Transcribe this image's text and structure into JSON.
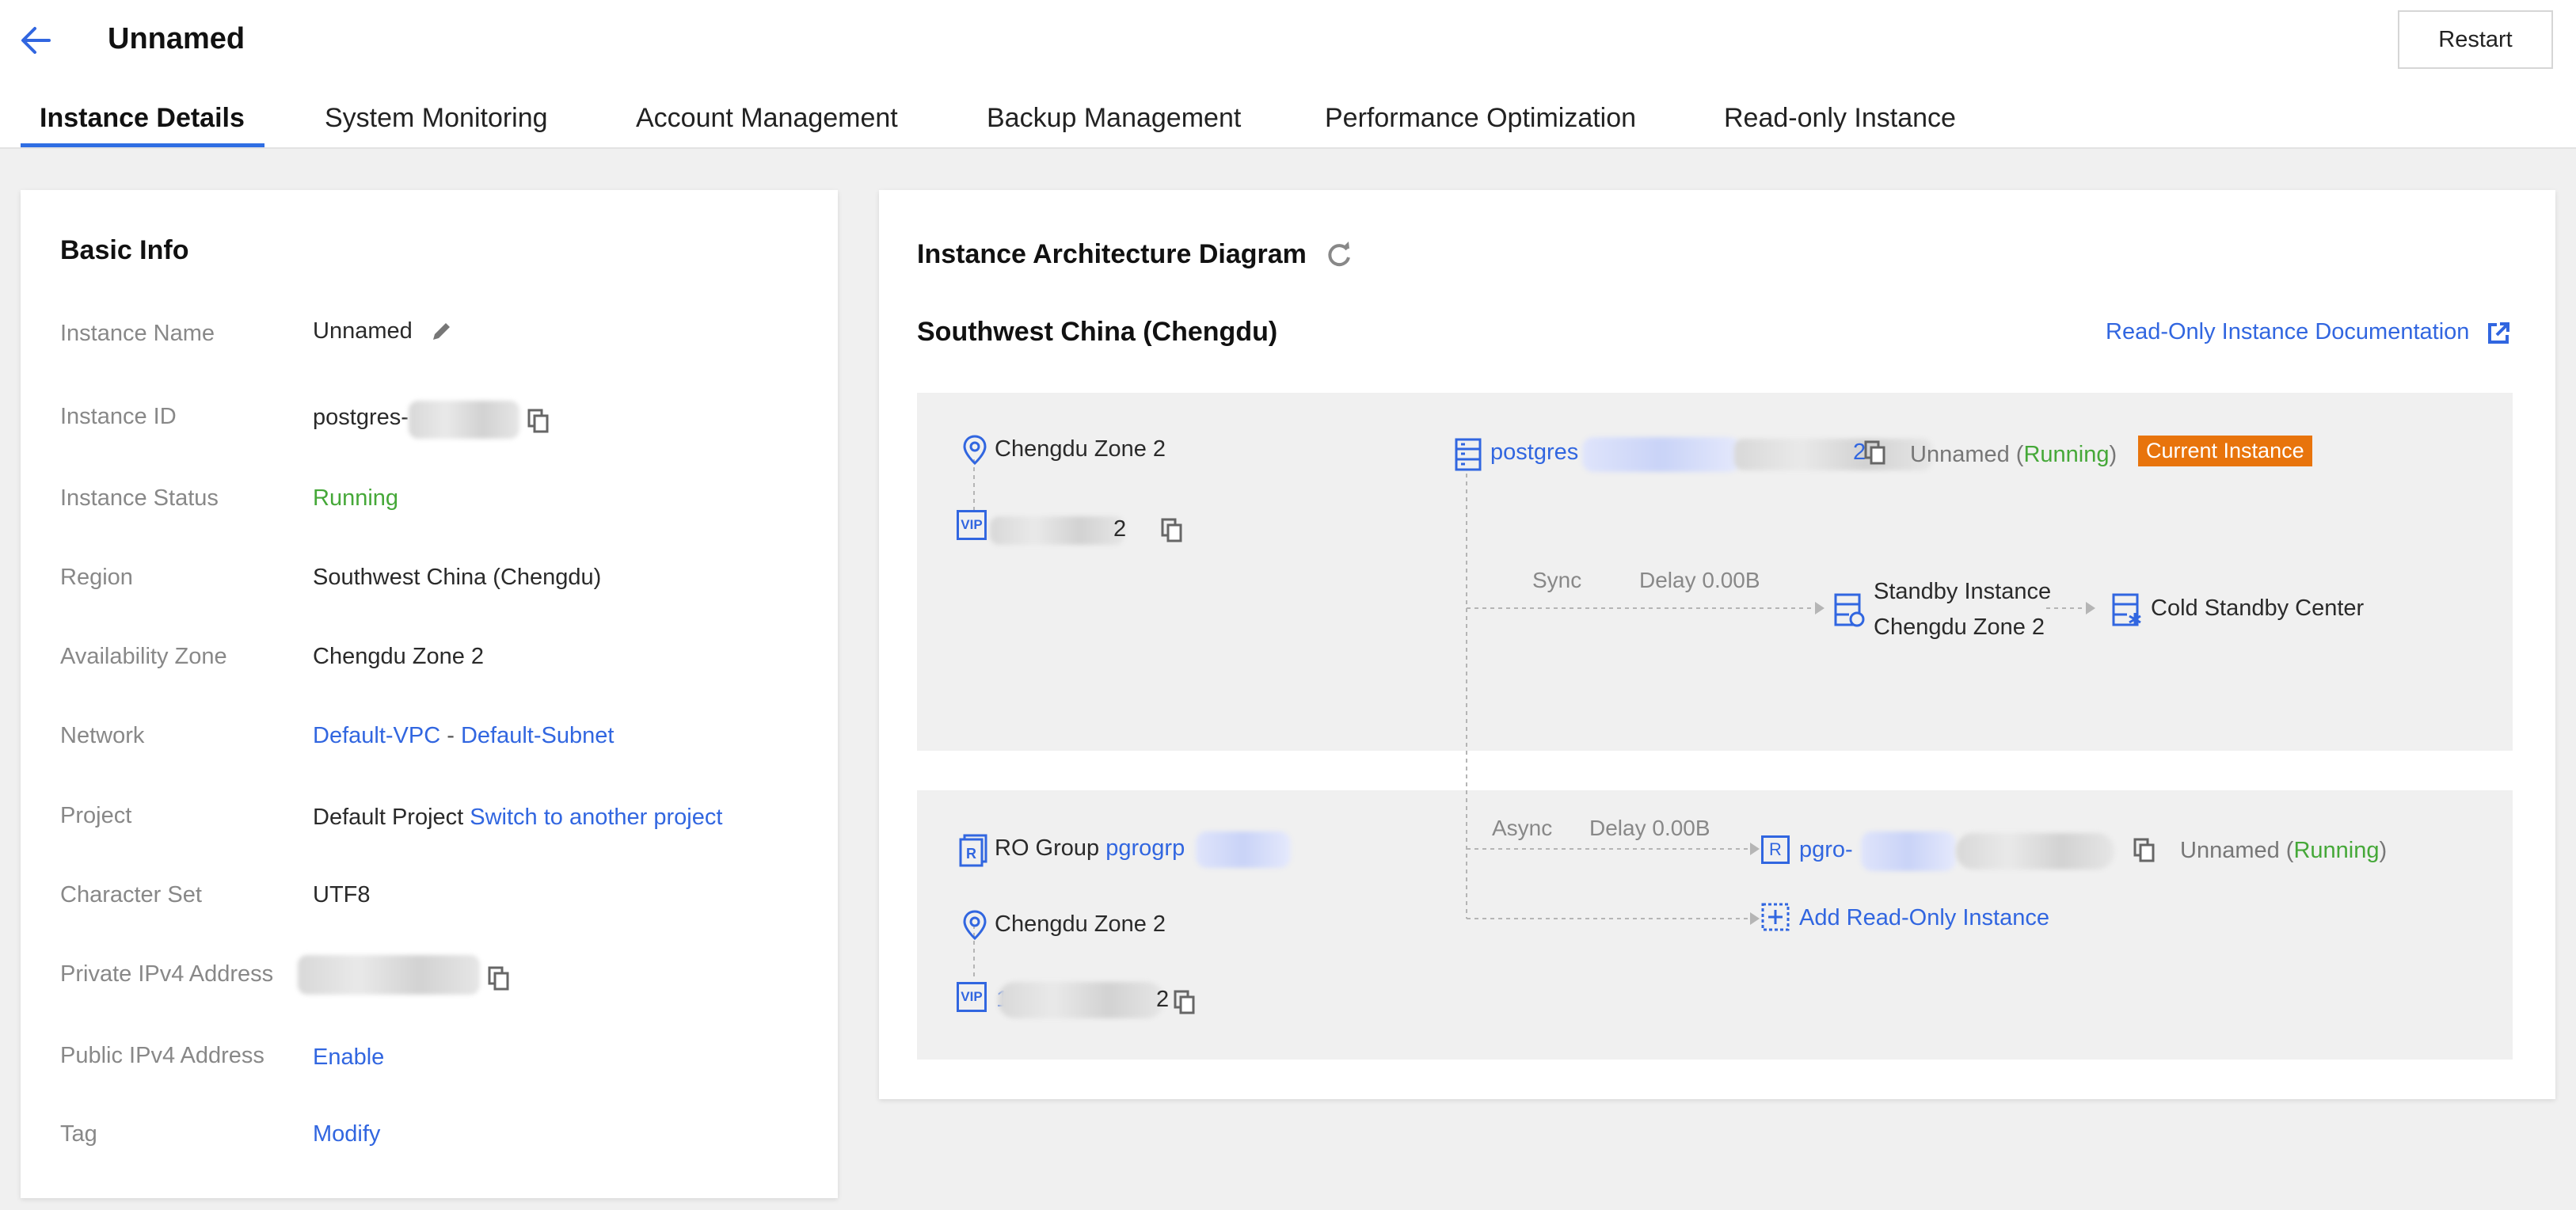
{
  "header": {
    "title": "Unnamed",
    "restart_label": "Restart",
    "tabs": [
      {
        "label": "Instance Details",
        "active": true
      },
      {
        "label": "System Monitoring"
      },
      {
        "label": "Account Management"
      },
      {
        "label": "Backup Management"
      },
      {
        "label": "Performance Optimization"
      },
      {
        "label": "Read-only Instance"
      }
    ]
  },
  "basic_info": {
    "title": "Basic Info",
    "rows": {
      "instance_name": {
        "label": "Instance Name",
        "value": "Unnamed"
      },
      "instance_id": {
        "label": "Instance ID",
        "value": "postgres-"
      },
      "instance_status": {
        "label": "Instance Status",
        "value": "Running"
      },
      "region": {
        "label": "Region",
        "value": "Southwest China (Chengdu)"
      },
      "availability_zone": {
        "label": "Availability Zone",
        "value": "Chengdu Zone 2"
      },
      "network": {
        "label": "Network",
        "vpc": "Default-VPC",
        "separator": "-",
        "subnet": "Default-Subnet"
      },
      "project": {
        "label": "Project",
        "value": "Default Project",
        "switch_link": "Switch to another project"
      },
      "character_set": {
        "label": "Character Set",
        "value": "UTF8"
      },
      "private_ipv4": {
        "label": "Private IPv4 Address"
      },
      "public_ipv4": {
        "label": "Public IPv4 Address",
        "action": "Enable"
      },
      "tag": {
        "label": "Tag",
        "action": "Modify"
      }
    }
  },
  "architecture": {
    "title": "Instance Architecture Diagram",
    "region_title": "Southwest China (Chengdu)",
    "doc_link": "Read-Only Instance Documentation",
    "primary": {
      "zone": "Chengdu Zone 2",
      "vip_badge": "VIP",
      "vip_suffix": "2",
      "instance_prefix": "postgres",
      "instance_suffix": "2",
      "name": "Unnamed",
      "status": "Running",
      "current_badge": "Current Instance",
      "sync_label": "Sync",
      "sync_delay": "Delay 0.00B",
      "standby_title": "Standby Instance",
      "standby_zone": "Chengdu Zone 2",
      "cold_standby": "Cold Standby Center"
    },
    "ro_group": {
      "group_label": "RO Group",
      "group_id": "pgrogrp",
      "zone": "Chengdu Zone 2",
      "vip_badge": "VIP",
      "vip_prefix": "1",
      "vip_suffix": "2",
      "async_label": "Async",
      "async_delay": "Delay 0.00B",
      "ro_badge": "R",
      "ro_instance_prefix": "pgro-",
      "ro_name": "Unnamed",
      "ro_status": "Running",
      "add_ro": "Add Read-Only Instance"
    }
  },
  "colors": {
    "accent": "#3166e0",
    "running": "#45a838",
    "badge_orange": "#e8740c",
    "tab_underline": "#2f6ee3"
  },
  "icons": [
    "back-arrow-icon",
    "edit-icon",
    "copy-icon",
    "refresh-icon",
    "external-link-icon",
    "location-icon",
    "vip-icon",
    "server-icon",
    "standby-icon",
    "cold-standby-icon",
    "ro-group-icon",
    "readonly-icon",
    "add-icon"
  ]
}
